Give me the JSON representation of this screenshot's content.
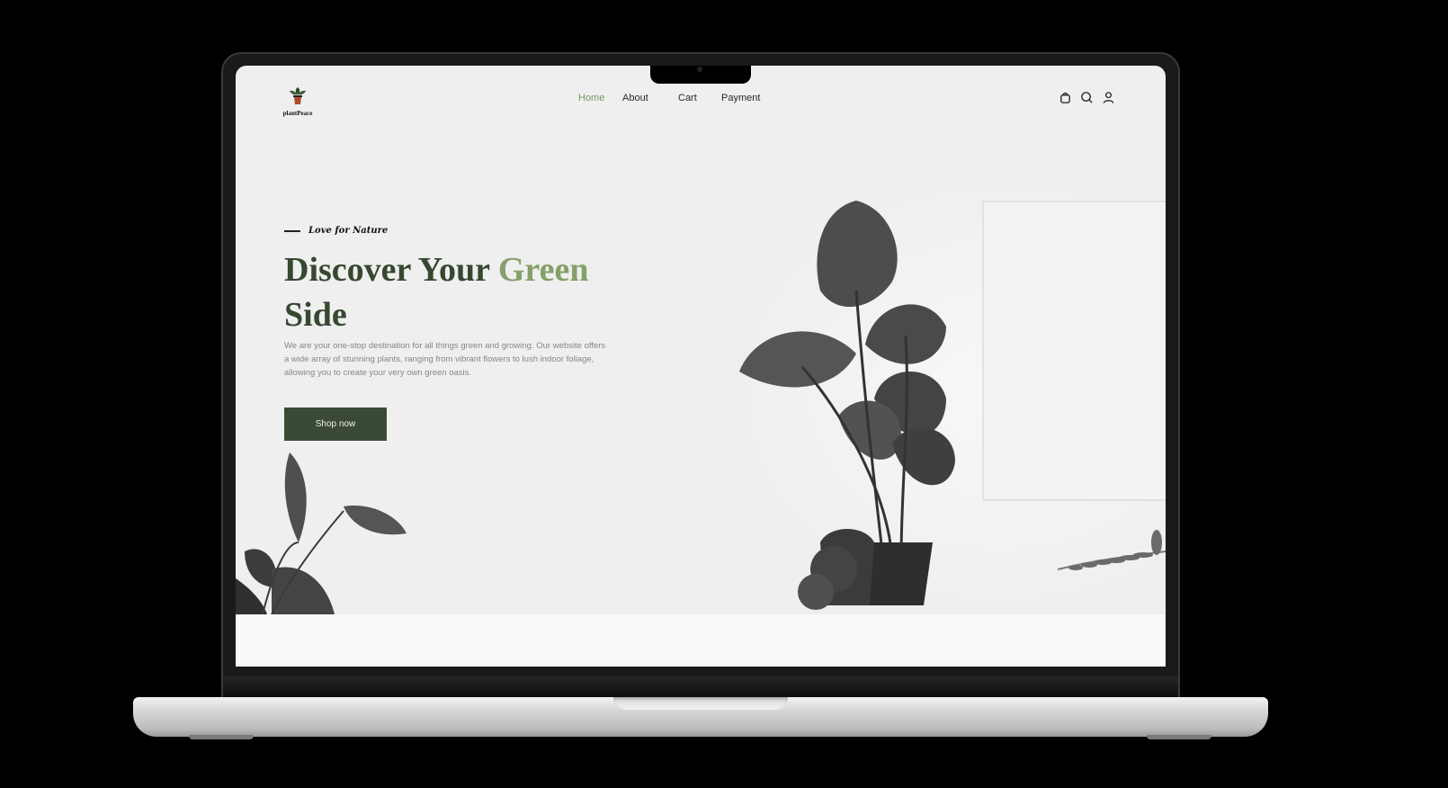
{
  "brand": {
    "name": "plantPeace"
  },
  "nav": {
    "items": [
      "Home",
      "About",
      "Cart",
      "Payment"
    ],
    "active": "Home"
  },
  "header_icons": [
    "bag-icon",
    "search-icon",
    "user-icon"
  ],
  "hero": {
    "tagline": "Love for Nature",
    "title_part1": "Discover Your ",
    "title_highlight": "Green",
    "title_part2": "Side",
    "description": "We are your one-stop destination for all things green and growing. Our website offers a wide array of stunning plants, ranging from vibrant flowers to lush indoor foliage, allowing you to create your very own green oasis.",
    "cta_label": "Shop now"
  },
  "colors": {
    "accent_green": "#85a06a",
    "dark_green": "#364830",
    "button": "#3b4a36",
    "nav_active": "#7a9763"
  }
}
